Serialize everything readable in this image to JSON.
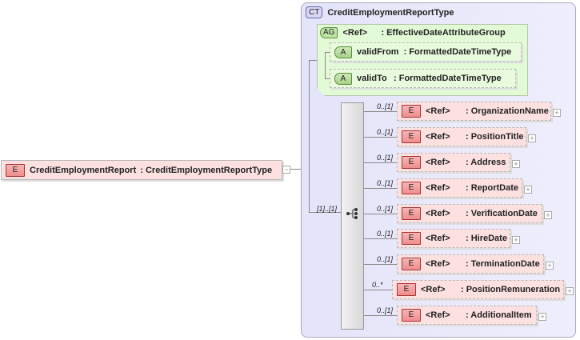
{
  "root": {
    "badge": "E",
    "name": "CreditEmploymentReport",
    "type": ": CreditEmploymentReportType",
    "collapse": "−"
  },
  "complex_type": {
    "badge": "CT",
    "name": "CreditEmploymentReportType"
  },
  "attribute_group": {
    "badge": "AG",
    "ref": "<Ref>",
    "name": ": EffectiveDateAttributeGroup",
    "attributes": [
      {
        "badge": "A",
        "name": "validFrom",
        "type": ": FormattedDateTimeType"
      },
      {
        "badge": "A",
        "name": "validTo",
        "type": ": FormattedDateTimeType"
      }
    ]
  },
  "sequence": {
    "multiplicity": "[1]..[1]"
  },
  "elements": [
    {
      "mult": "0..[1]",
      "badge": "E",
      "ref": "<Ref>",
      "name": ": OrganizationName",
      "expand": "+"
    },
    {
      "mult": "0..[1]",
      "badge": "E",
      "ref": "<Ref>",
      "name": ": PositionTitle",
      "expand": "+"
    },
    {
      "mult": "0..[1]",
      "badge": "E",
      "ref": "<Ref>",
      "name": ": Address",
      "expand": "+"
    },
    {
      "mult": "0..[1]",
      "badge": "E",
      "ref": "<Ref>",
      "name": ": ReportDate",
      "expand": "+"
    },
    {
      "mult": "0..[1]",
      "badge": "E",
      "ref": "<Ref>",
      "name": ": VerificationDate",
      "expand": "+"
    },
    {
      "mult": "0..[1]",
      "badge": "E",
      "ref": "<Ref>",
      "name": ": HireDate",
      "expand": "+"
    },
    {
      "mult": "0..[1]",
      "badge": "E",
      "ref": "<Ref>",
      "name": ": TerminationDate",
      "expand": "+"
    },
    {
      "mult": "0..*",
      "badge": "E",
      "ref": "<Ref>",
      "name": ": PositionRemuneration",
      "expand": "+"
    },
    {
      "mult": "0..[1]",
      "badge": "E",
      "ref": "<Ref>",
      "name": ": AdditionalItem",
      "expand": "+"
    }
  ]
}
